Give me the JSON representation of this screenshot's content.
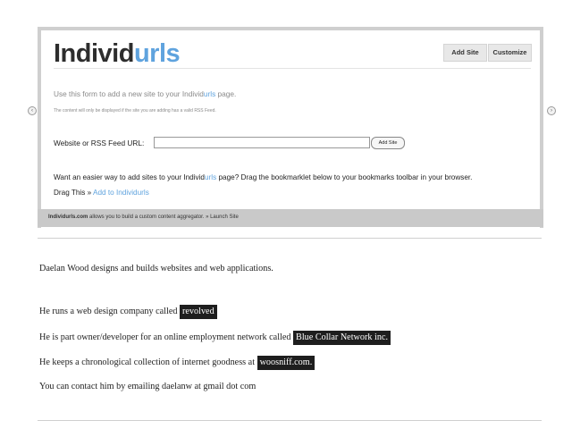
{
  "nav": {
    "left_glyph": "‹",
    "right_glyph": "›"
  },
  "logo": {
    "part1": "Individ",
    "part2": "urls"
  },
  "toolbar": {
    "add_site_label": "Add Site",
    "customize_label": "Customize"
  },
  "intro": {
    "prefix": "Use this form to add a new site to your Individ",
    "highlight": "urls",
    "suffix": " page."
  },
  "note": "The content will only be displayed if the site you are adding has a valid RSS Feed.",
  "form": {
    "label": "Website or RSS Feed URL:",
    "value": "",
    "button_label": "Add Site"
  },
  "bookmarklet": {
    "prefix": "Want an easier way to add sites to your Individ",
    "highlight": "urls",
    "suffix": " page? Drag the bookmarklet below to your bookmarks toolbar in your browser.",
    "drag_label": "Drag This »",
    "link_label": "Add to Individurls"
  },
  "footer": {
    "brand": "Individurls.com",
    "text": " allows you to build a custom content aggregator. » Launch Site"
  },
  "bio": {
    "line1": "Daelan Wood designs and builds websites and web applications.",
    "line2_prefix": "He runs a web design company called ",
    "line2_tag": "revolved",
    "line3_prefix": "He is part owner/developer for an online employment network called ",
    "line3_tag": "Blue Collar Network inc.",
    "line4_prefix": "He keeps a chronological collection of internet goodness at ",
    "line4_tag": "woosniff.com.",
    "line5": "You can contact him by emailing daelanw at gmail dot com"
  },
  "colors": {
    "accent": "#5fa3de",
    "logo_dark": "#2d2d2d",
    "frame_gray": "#cfcfcf",
    "tag_bg": "#1e1e1e"
  }
}
